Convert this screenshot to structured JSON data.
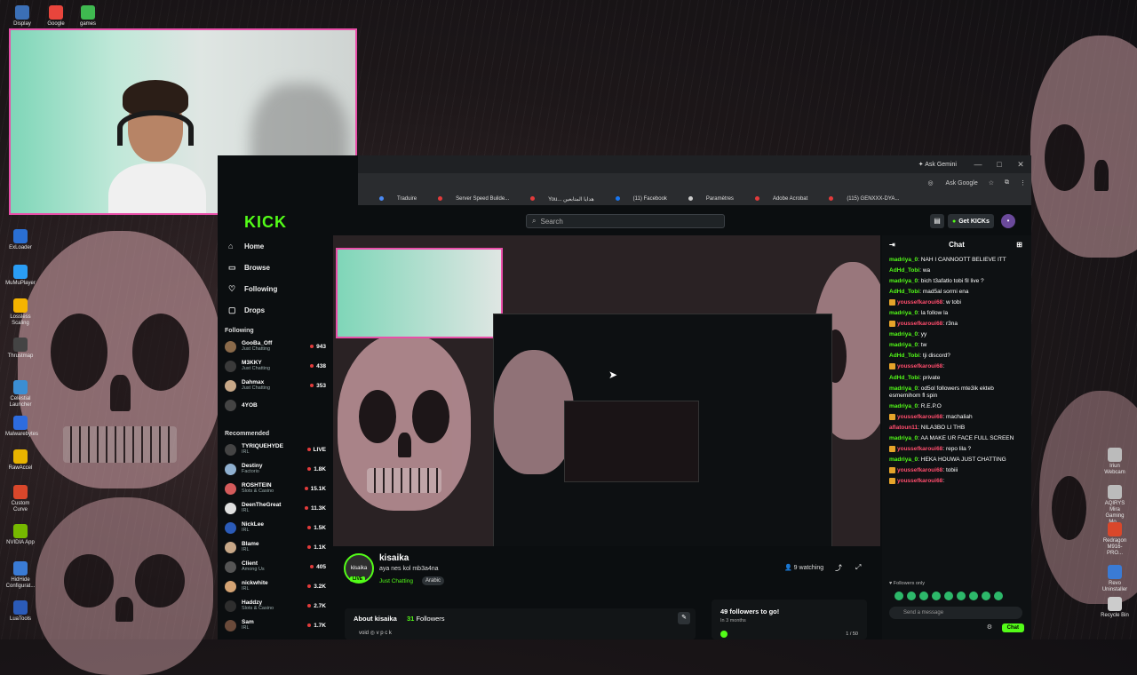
{
  "desktop": {
    "icons_left": [
      {
        "label": "Display",
        "color": "#3b6fb6"
      },
      {
        "label": "Google",
        "color": "#e8453c"
      },
      {
        "label": "games",
        "color": "#3fb950"
      },
      {
        "label": "ExLoader",
        "color": "#2a6fd3"
      },
      {
        "label": "MuMuPlayer",
        "color": "#2a9df4"
      },
      {
        "label": "Lossless Scaling",
        "color": "#f5b400"
      },
      {
        "label": "Thrustmap",
        "color": "#444444"
      },
      {
        "label": "Celestial Launcher",
        "color": "#3b8ed3"
      },
      {
        "label": "Malwarebytes",
        "color": "#2d6cdf"
      },
      {
        "label": "RawAccel",
        "color": "#e8b400"
      },
      {
        "label": "Custom Curve",
        "color": "#d9472b"
      },
      {
        "label": "NVIDIA App",
        "color": "#76b900"
      },
      {
        "label": "HidHide Configurat...",
        "color": "#3a7bd5"
      },
      {
        "label": "LuaTools",
        "color": "#2b5bb8"
      }
    ],
    "icons_right": [
      {
        "label": "Iriun Webcam",
        "color": "#bbbbbb"
      },
      {
        "label": "AQIRYS Mira Gaming Mo...",
        "color": "#bbbbbb"
      },
      {
        "label": "Redragon M916-PRO...",
        "color": "#d9472b"
      },
      {
        "label": "Revo Uninstaller",
        "color": "#3a7bd5"
      },
      {
        "label": "Recycle Bin",
        "color": "#cccccc"
      }
    ]
  },
  "browser": {
    "titlebar": {
      "ask_gemini": "Ask Gemini",
      "minimize": "—",
      "maximize": "□",
      "close": "✕"
    },
    "addrbar": {
      "ask_google": "Ask Google"
    },
    "bookmarks": [
      {
        "label": "Traduire",
        "color": "#4a8af4"
      },
      {
        "label": "Server Speed Builde...",
        "color": "#e23b3b"
      },
      {
        "label": "You... هدايا المتابعين",
        "color": "#e23b3b"
      },
      {
        "label": "(11) Facebook",
        "color": "#1877f2"
      },
      {
        "label": "Paramètres",
        "color": "#cccccc"
      },
      {
        "label": "Adobe Acrobat",
        "color": "#e23b3b"
      },
      {
        "label": "(115) GENXXX-DYA...",
        "color": "#e23b3b"
      }
    ]
  },
  "kick": {
    "logo": "KICK",
    "search_placeholder": "Search",
    "get_kicks": "Get KICKs",
    "nav": [
      {
        "label": "Home",
        "icon": "home-icon",
        "glyph": "⌂"
      },
      {
        "label": "Browse",
        "icon": "browse-icon",
        "glyph": "▭"
      },
      {
        "label": "Following",
        "icon": "heart-icon",
        "glyph": "♡"
      },
      {
        "label": "Drops",
        "icon": "drops-icon",
        "glyph": "▢"
      }
    ],
    "following_header": "Following",
    "following": [
      {
        "name": "GooBa_Off",
        "category": "Just Chatting",
        "viewers": "943"
      },
      {
        "name": "M3KKY",
        "category": "Just Chatting",
        "viewers": "438"
      },
      {
        "name": "Dahmax",
        "category": "Just Chatting",
        "viewers": "353"
      },
      {
        "name": "4YOB",
        "category": "",
        "viewers": ""
      }
    ],
    "recommended_header": "Recommended",
    "recommended": [
      {
        "name": "TYRIQUEHYDE",
        "category": "IRL",
        "viewers": "LIVE"
      },
      {
        "name": "Destiny",
        "category": "Factorio",
        "viewers": "1.8K"
      },
      {
        "name": "ROSHTEIN",
        "category": "Slots & Casino",
        "viewers": "15.1K"
      },
      {
        "name": "DeenTheGreat",
        "category": "IRL",
        "viewers": "11.3K"
      },
      {
        "name": "NickLee",
        "category": "IRL",
        "viewers": "1.5K"
      },
      {
        "name": "Blame",
        "category": "IRL",
        "viewers": "1.1K"
      },
      {
        "name": "Client",
        "category": "Among Us",
        "viewers": "405"
      },
      {
        "name": "nickwhite",
        "category": "IRL",
        "viewers": "3.2K"
      },
      {
        "name": "Haddzy",
        "category": "Slots & Casino",
        "viewers": "2.7K"
      },
      {
        "name": "Sam",
        "category": "IRL",
        "viewers": "1.7K"
      }
    ],
    "stream": {
      "channel": "kisaika",
      "avatar_text": "kisaika",
      "title": "aya nes kol mb3a4na",
      "category": "Just Chatting",
      "tag": "Arabic",
      "live_badge": "LIVE",
      "watching": "9 watching",
      "about_label": "About kisaika",
      "followers_count": "31",
      "followers_label": "Followers",
      "socials": "void   ◎ v p c k",
      "goal_title": "49 followers to go!",
      "goal_sub": "In 3 months",
      "goal_count": "1 / 50"
    },
    "chat": {
      "header": "Chat",
      "messages": [
        {
          "user": "madriya_0",
          "color": "#53fc18",
          "text": "NAH I CANNOOTT BELIEVE ITT",
          "badge": false
        },
        {
          "user": "AdHd_Tobi",
          "color": "#53fc18",
          "text": "wa",
          "badge": false
        },
        {
          "user": "madriya_0",
          "color": "#53fc18",
          "text": "bich t3afatlo tobi fil live ?",
          "badge": false
        },
        {
          "user": "AdHd_Tobi",
          "color": "#53fc18",
          "text": "mad5al sormi ena",
          "badge": false
        },
        {
          "user": "youssefkaroui68",
          "color": "#ff4d6d",
          "text": "w tobi",
          "badge": true
        },
        {
          "user": "madriya_0",
          "color": "#53fc18",
          "text": "la follow la",
          "badge": false
        },
        {
          "user": "youssefkaroui68",
          "color": "#ff4d6d",
          "text": "r3na",
          "badge": true
        },
        {
          "user": "madriya_0",
          "color": "#53fc18",
          "text": "yy",
          "badge": false
        },
        {
          "user": "madriya_0",
          "color": "#53fc18",
          "text": "tw",
          "badge": false
        },
        {
          "user": "AdHd_Tobi",
          "color": "#53fc18",
          "text": "tji discord?",
          "badge": false
        },
        {
          "user": "youssefkaroui68",
          "color": "#ff4d6d",
          "text": "",
          "badge": true
        },
        {
          "user": "AdHd_Tobi",
          "color": "#53fc18",
          "text": "private",
          "badge": false
        },
        {
          "user": "madriya_0",
          "color": "#53fc18",
          "text": "od5ol followers mte3ik ekteb esmemihom fl spin",
          "badge": false
        },
        {
          "user": "madriya_0",
          "color": "#53fc18",
          "text": "R.E.P.O",
          "badge": false
        },
        {
          "user": "youssefkaroui68",
          "color": "#ff4d6d",
          "text": "machaliah",
          "badge": true
        },
        {
          "user": "aflatoun11",
          "color": "#ff4d6d",
          "text": "NILA3BO LI THB",
          "badge": false
        },
        {
          "user": "madriya_0",
          "color": "#53fc18",
          "text": "AA MAKE UR FACE FULL SCREEN",
          "badge": false
        },
        {
          "user": "youssefkaroui68",
          "color": "#ff4d6d",
          "text": "repo lila ?",
          "badge": true
        },
        {
          "user": "madriya_0",
          "color": "#53fc18",
          "text": "HEKA HOUWA JUST CHATTING",
          "badge": false
        },
        {
          "user": "youssefkaroui68",
          "color": "#ff4d6d",
          "text": "tobiii",
          "badge": true
        },
        {
          "user": "youssefkaroui68",
          "color": "#ff4d6d",
          "text": "",
          "badge": true
        }
      ],
      "followers_only": "♥ Followers only",
      "input_placeholder": "Send a message",
      "send_label": "Chat"
    }
  },
  "colors": {
    "accent": "#53fc18",
    "pink_border": "#e94fa9"
  }
}
